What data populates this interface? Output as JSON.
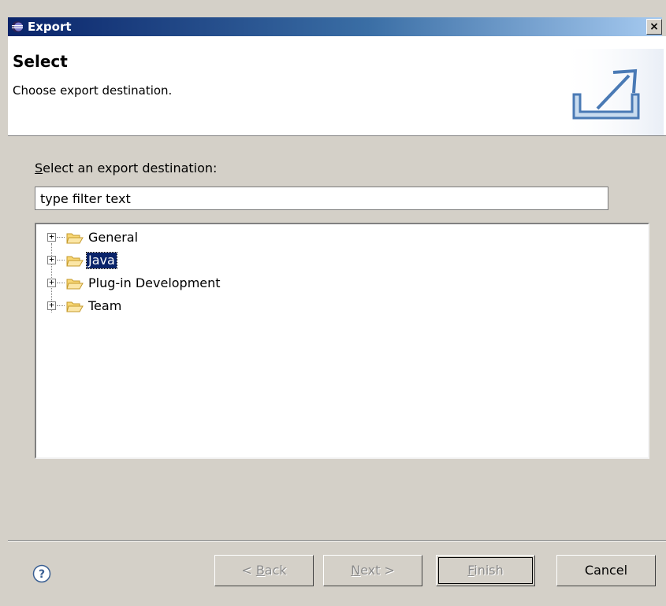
{
  "window": {
    "title": "Export",
    "close_glyph": "×",
    "title_icon": "eclipse-icon"
  },
  "banner": {
    "title": "Select",
    "description": "Choose export destination.",
    "image": "export-wizard-icon"
  },
  "filter": {
    "label_accel": "S",
    "label_rest": "elect an export destination:",
    "placeholder": "type filter text"
  },
  "tree": {
    "items": [
      {
        "label": "General",
        "icon": "folder-icon",
        "expander": "+",
        "selected": false
      },
      {
        "label": "Java",
        "icon": "folder-icon",
        "expander": "+",
        "selected": true
      },
      {
        "label": "Plug-in Development",
        "icon": "folder-icon",
        "expander": "+",
        "selected": false
      },
      {
        "label": "Team",
        "icon": "folder-icon",
        "expander": "+",
        "selected": false
      }
    ]
  },
  "buttons": {
    "help_icon": "help-icon",
    "back": {
      "prefix": "< ",
      "accel": "B",
      "rest": "ack",
      "enabled": false
    },
    "next": {
      "accel": "N",
      "rest": "ext >",
      "enabled": false
    },
    "finish": {
      "accel": "F",
      "rest": "inish",
      "enabled": false
    },
    "cancel": {
      "label": "Cancel",
      "enabled": true
    }
  },
  "colors": {
    "selection": "#0a246a",
    "titlebar_start": "#0a246a",
    "titlebar_end": "#a6caf0",
    "dialog_bg": "#d4d0c8"
  }
}
